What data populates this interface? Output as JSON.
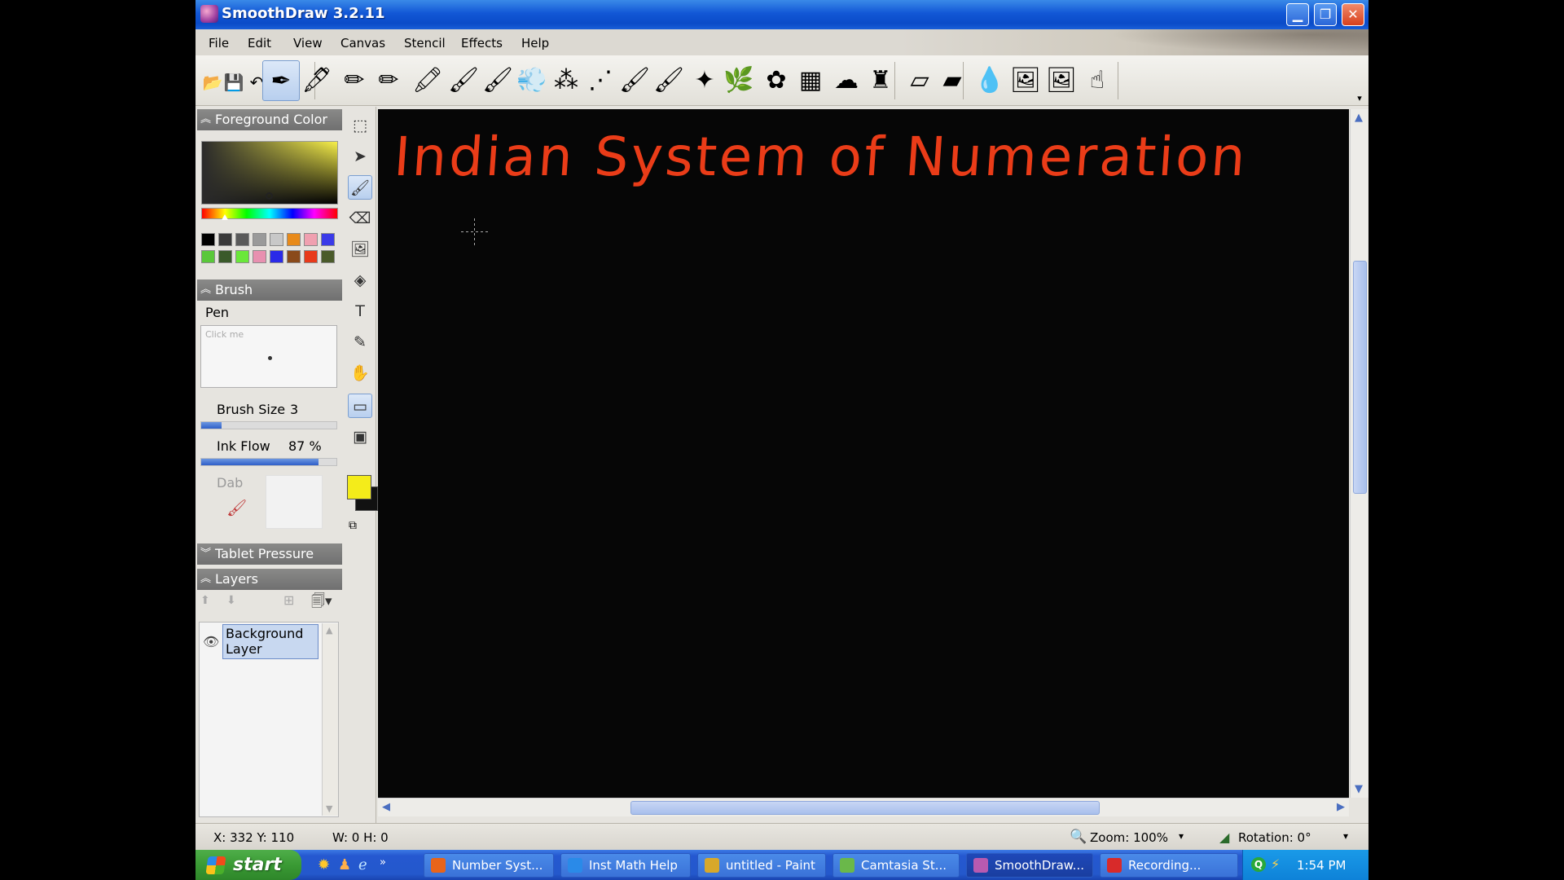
{
  "window": {
    "title": "SmoothDraw 3.2.11",
    "min_glyph": "▁",
    "max_glyph": "❐",
    "close_glyph": "✕"
  },
  "menu": [
    "File",
    "Edit",
    "View",
    "Canvas",
    "Stencil",
    "Effects",
    "Help"
  ],
  "toolbar": {
    "file_actions": [
      {
        "name": "open-icon",
        "glyph": "📂"
      },
      {
        "name": "save-icon",
        "glyph": "💾"
      },
      {
        "name": "undo-icon",
        "glyph": "↶"
      },
      {
        "name": "redo-icon",
        "glyph": "↷"
      }
    ],
    "brushes": [
      {
        "name": "pen-brush",
        "glyph": "✒"
      },
      {
        "name": "ink-pen-brush",
        "glyph": "🖋"
      },
      {
        "name": "pencil-brush",
        "glyph": "✏"
      },
      {
        "name": "red-pencil-brush",
        "glyph": "✏"
      },
      {
        "name": "highlighter-brush",
        "glyph": "🖍"
      },
      {
        "name": "chalk-brush",
        "glyph": "🖌"
      },
      {
        "name": "oil-brush",
        "glyph": "🖌"
      },
      {
        "name": "airbrush-brush",
        "glyph": "💨"
      },
      {
        "name": "spray-brush",
        "glyph": "⁂"
      },
      {
        "name": "fine-spray-brush",
        "glyph": "⋰"
      },
      {
        "name": "paint-brush",
        "glyph": "🖌"
      },
      {
        "name": "watercolor-brush",
        "glyph": "🖌"
      },
      {
        "name": "sparkle-brush",
        "glyph": "✦"
      },
      {
        "name": "grass-brush",
        "glyph": "🌿"
      },
      {
        "name": "flower-brush",
        "glyph": "✿"
      },
      {
        "name": "texture-brush",
        "glyph": "▦"
      },
      {
        "name": "smudge-brush",
        "glyph": "☁"
      },
      {
        "name": "stamp-brush",
        "glyph": "♜"
      },
      {
        "name": "eraser-brush",
        "glyph": "▱"
      },
      {
        "name": "soft-eraser-brush",
        "glyph": "▰"
      },
      {
        "name": "water-drop-brush",
        "glyph": "💧"
      },
      {
        "name": "image-brush",
        "glyph": "🖼"
      },
      {
        "name": "image-stamp-brush",
        "glyph": "🖼"
      },
      {
        "name": "finger-smudge-brush",
        "glyph": "☝"
      }
    ],
    "overflow_glyph": "▾"
  },
  "panels": {
    "foreground": {
      "header": "Foreground Color",
      "swatches": [
        "#000000",
        "#3a3a3a",
        "#5a5a5a",
        "#9a9a9a",
        "#c8c8c8",
        "#e88a1a",
        "#f0a0b0",
        "#3a3ae8",
        "#5ac83a",
        "#3a5a2a",
        "#6ae83a",
        "#e890b0",
        "#2a2ae8",
        "#8a4a1a",
        "#e83a1a",
        "#4a5a2a"
      ]
    },
    "brush": {
      "header": "Brush",
      "name": "Pen",
      "preview_hint": "Click me",
      "size_label": "Brush Size",
      "size_value": "3",
      "size_fraction": 0.15,
      "ink_flow_label": "Ink Flow",
      "ink_flow_value": "87 %",
      "ink_flow_fraction": 0.87,
      "dab_label": "Dab"
    },
    "tablet": {
      "header": "Tablet Pressure"
    },
    "layers": {
      "header": "Layers",
      "items": [
        {
          "name": "Background Layer"
        }
      ]
    }
  },
  "tools": [
    {
      "name": "select-rect-tool",
      "glyph": "⬚",
      "active": false
    },
    {
      "name": "move-tool",
      "glyph": "➤",
      "active": false
    },
    {
      "name": "brush-tool",
      "glyph": "🖌",
      "active": true
    },
    {
      "name": "eraser-tool",
      "glyph": "⌫",
      "active": false
    },
    {
      "name": "image-tool",
      "glyph": "🖼",
      "active": false
    },
    {
      "name": "fill-tool",
      "glyph": "◈",
      "active": false
    },
    {
      "name": "text-tool",
      "glyph": "T",
      "active": false
    },
    {
      "name": "eyedropper-tool",
      "glyph": "✎",
      "active": false
    },
    {
      "name": "hand-tool",
      "glyph": "✋",
      "active": false
    },
    {
      "name": "rectangle-tool",
      "glyph": "▭",
      "active": true
    },
    {
      "name": "stencil-tool",
      "glyph": "▣",
      "active": false
    }
  ],
  "colors": {
    "foreground": "#f4ec1a",
    "background": "#111111",
    "ink": "#ea3c18"
  },
  "canvas": {
    "heading": "Indian System of Numeration"
  },
  "status": {
    "coords": "X: 332 Y: 110",
    "size": "W: 0 H: 0",
    "zoom": "Zoom: 100%",
    "rotation": "Rotation: 0°"
  },
  "taskbar": {
    "start": "start",
    "tasks": [
      {
        "label": "Number Syst...",
        "icon_color": "#e8641a",
        "active": false
      },
      {
        "label": "Inst Math Help",
        "icon_color": "#2a8ae8",
        "active": false
      },
      {
        "label": "untitled - Paint",
        "icon_color": "#d8a82a",
        "active": false
      },
      {
        "label": "Camtasia St...",
        "icon_color": "#6ab84a",
        "active": false
      },
      {
        "label": "SmoothDraw...",
        "icon_color": "#b85ab0",
        "active": true
      },
      {
        "label": "Recording...",
        "icon_color": "#d82a2a",
        "active": false
      }
    ],
    "clock": "1:54 PM"
  }
}
